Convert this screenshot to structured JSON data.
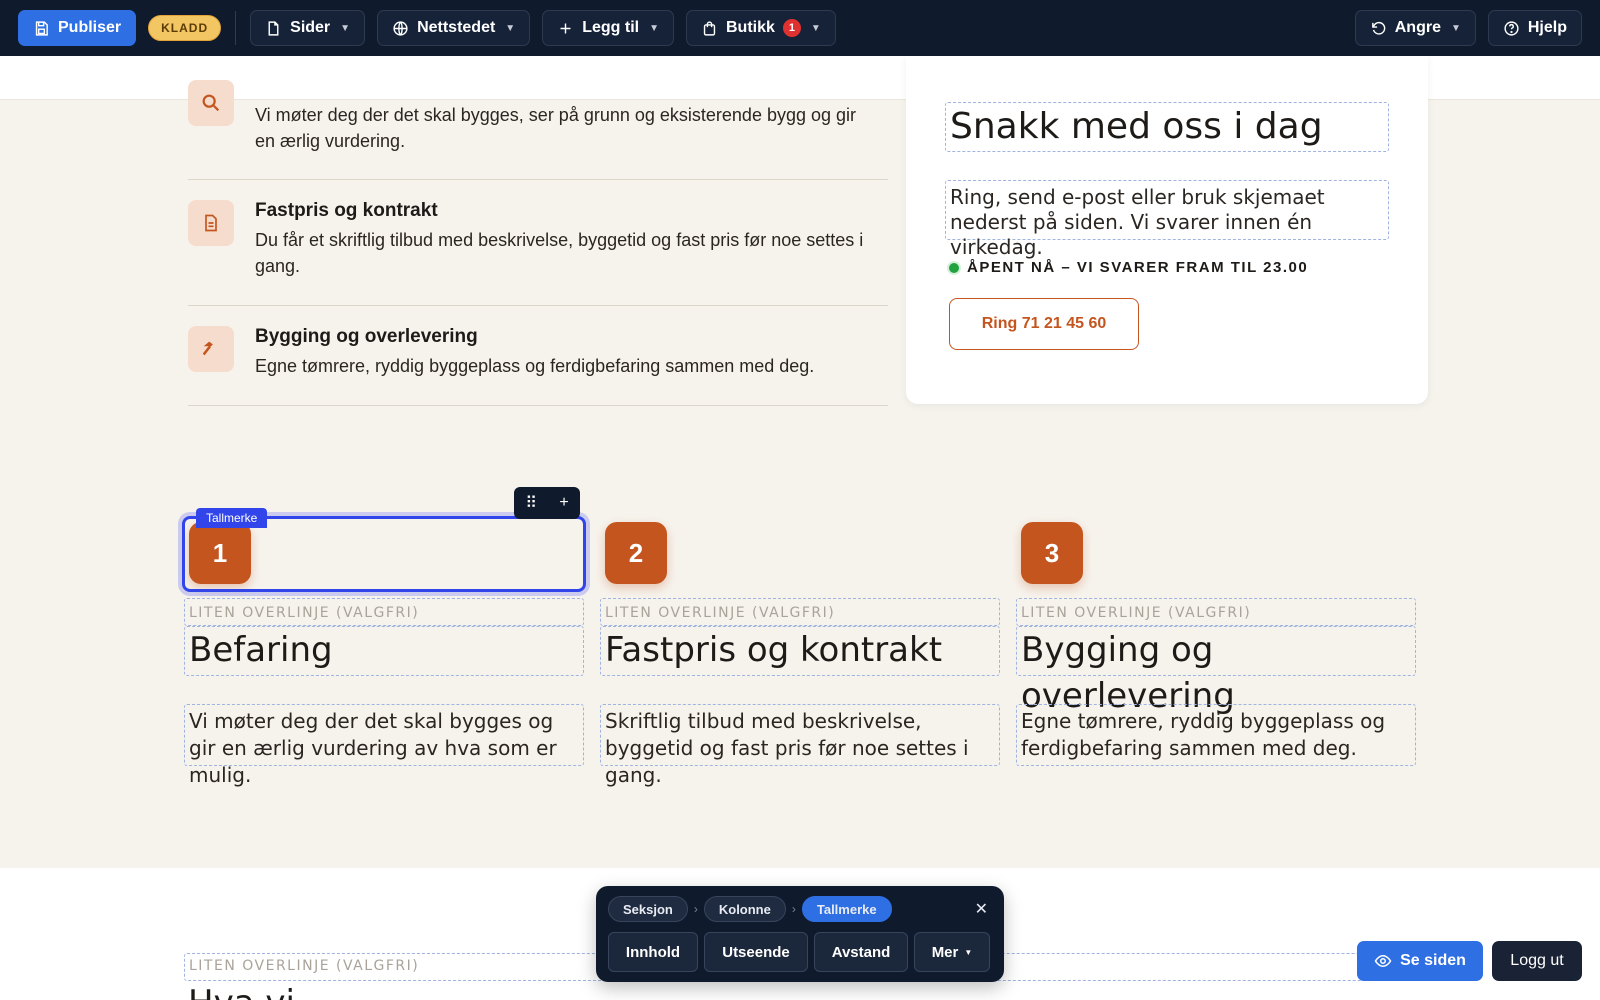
{
  "toolbar": {
    "publish": "Publiser",
    "draft": "KLADD",
    "pages": "Sider",
    "site": "Nettstedet",
    "add": "Legg til",
    "shop": "Butikk",
    "shop_count": "1",
    "undo": "Angre",
    "help": "Hjelp"
  },
  "process": {
    "items": [
      {
        "title": "",
        "text": "Vi møter deg der det skal bygges, ser på grunn og eksisterende bygg og gir en ærlig vurdering.",
        "icon": "search-icon"
      },
      {
        "title": "Fastpris og kontrakt",
        "text": "Du får et skriftlig tilbud med beskrivelse, byggetid og fast pris før noe settes i gang.",
        "icon": "document-icon"
      },
      {
        "title": "Bygging og overlevering",
        "text": "Egne tømrere, ryddig byggeplass og ferdigbefaring sammen med deg.",
        "icon": "hammer-icon"
      }
    ]
  },
  "contact": {
    "title": "Snakk med oss i dag",
    "text": "Ring, send e-post eller bruk skjemaet nederst på siden. Vi svarer innen én virkedag.",
    "status": "ÅPENT NÅ – VI SVARER FRAM TIL 23.00",
    "call_button": "Ring 71 21 45 60"
  },
  "steps": [
    {
      "number": "1",
      "overline": "LITEN OVERLINJE (VALGFRI)",
      "title": "Befaring",
      "text": "Vi møter deg der det skal bygges og gir en ærlig vurdering av hva som er mulig."
    },
    {
      "number": "2",
      "overline": "LITEN OVERLINJE (VALGFRI)",
      "title": "Fastpris og kontrakt",
      "text": "Skriftlig tilbud med beskrivelse, byggetid og fast pris før noe settes i gang."
    },
    {
      "number": "3",
      "overline": "LITEN OVERLINJE (VALGFRI)",
      "title": "Bygging og overlevering",
      "text": "Egne tømrere, ryddig byggeplass og ferdigbefaring sammen med deg."
    }
  ],
  "selection": {
    "label": "Tallmerke"
  },
  "lower": {
    "overline": "LITEN OVERLINJE (VALGFRI)",
    "title": "Hva vi"
  },
  "panel": {
    "crumbs": [
      "Seksjon",
      "Kolonne",
      "Tallmerke"
    ],
    "tabs": [
      "Innhold",
      "Utseende",
      "Avstand",
      "Mer"
    ]
  },
  "actions": {
    "view": "Se siden",
    "logout": "Logg ut"
  },
  "colors": {
    "accent": "#c4551f",
    "primary": "#2f6fe4",
    "toolbar": "#0f1a2c",
    "selection": "#3145ea"
  }
}
